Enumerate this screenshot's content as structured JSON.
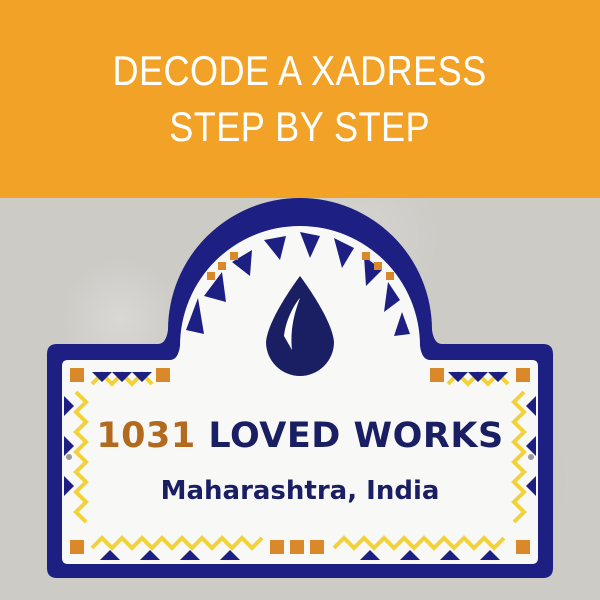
{
  "banner": {
    "line1": "DECODE A XADRESS",
    "line2": "STEP BY STEP"
  },
  "plaque": {
    "number": "1031",
    "street": "LOVED WORKS",
    "region": "Maharashtra, India",
    "icon": "water-drop-icon"
  },
  "colors": {
    "banner": "#f2a327",
    "plaque_border": "#1d1f82",
    "text_navy": "#1a1e63",
    "number_brown": "#b16a1e",
    "tile_orange": "#d9882a",
    "tile_yellow": "#f2d23a"
  }
}
